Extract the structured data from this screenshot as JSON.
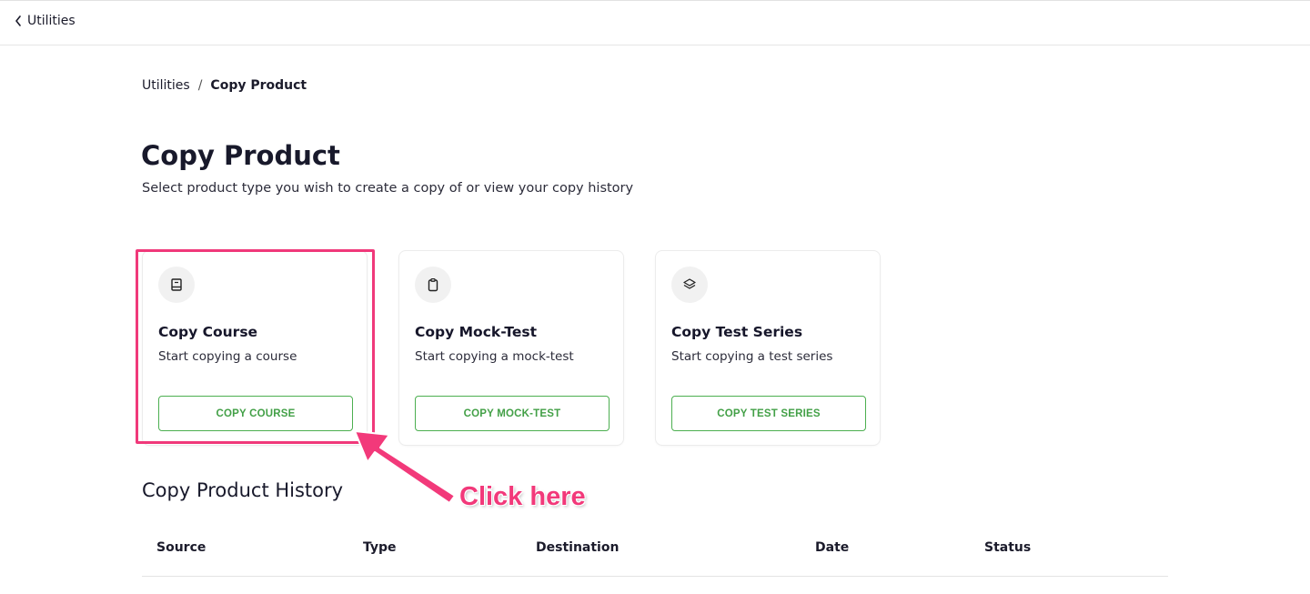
{
  "topbar": {
    "back_label": "Utilities"
  },
  "breadcrumb": {
    "parent": "Utilities",
    "separator": "/",
    "current": "Copy Product"
  },
  "page": {
    "title": "Copy Product",
    "subtitle": "Select product type you wish to create a copy of or view your copy history"
  },
  "cards": [
    {
      "icon": "book-icon",
      "title": "Copy Course",
      "description": "Start copying a course",
      "button_label": "COPY COURSE"
    },
    {
      "icon": "clipboard-icon",
      "title": "Copy Mock-Test",
      "description": "Start copying a mock-test",
      "button_label": "COPY MOCK-TEST"
    },
    {
      "icon": "layers-icon",
      "title": "Copy Test Series",
      "description": "Start copying a test series",
      "button_label": "COPY TEST SERIES"
    }
  ],
  "annotation": {
    "text": "Click here",
    "color": "#f2397a"
  },
  "history": {
    "title": "Copy Product History",
    "columns": [
      "Source",
      "Type",
      "Destination",
      "Date",
      "Status"
    ]
  },
  "colors": {
    "accent_green": "#43a047",
    "highlight_pink": "#f0397a"
  }
}
